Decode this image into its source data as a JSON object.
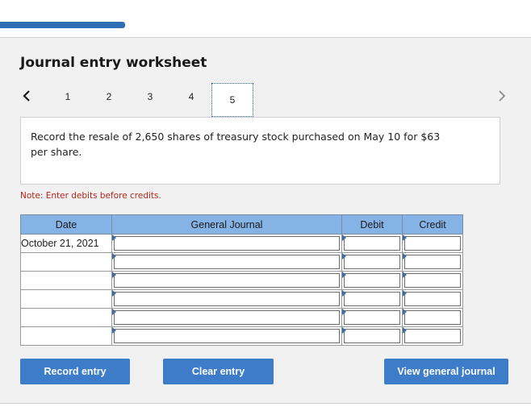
{
  "header": {
    "title": "Journal entry worksheet"
  },
  "steps": {
    "prev_icon": "chevron-left-icon",
    "next_icon": "chevron-right-icon",
    "items": [
      "1",
      "2",
      "3",
      "4",
      "5"
    ],
    "active": "5"
  },
  "prompt": {
    "text": "Record the resale of 2,650 shares of treasury stock purchased on May 10 for $63 per share."
  },
  "note": "Note: Enter debits before credits.",
  "journal": {
    "headers": {
      "date": "Date",
      "general_journal": "General Journal",
      "debit": "Debit",
      "credit": "Credit"
    },
    "rows": [
      {
        "date": "October 21, 2021",
        "account": "",
        "debit": "",
        "credit": ""
      },
      {
        "date": "",
        "account": "",
        "debit": "",
        "credit": ""
      },
      {
        "date": "",
        "account": "",
        "debit": "",
        "credit": ""
      },
      {
        "date": "",
        "account": "",
        "debit": "",
        "credit": ""
      },
      {
        "date": "",
        "account": "",
        "debit": "",
        "credit": ""
      },
      {
        "date": "",
        "account": "",
        "debit": "",
        "credit": ""
      }
    ]
  },
  "buttons": {
    "record": "Record entry",
    "clear": "Clear entry",
    "view": "View general journal"
  },
  "colors": {
    "accent": "#3d7cc9",
    "header_fill": "#86b3e6",
    "note_red": "#b3261e",
    "panel_bg": "#f1f1f1"
  }
}
